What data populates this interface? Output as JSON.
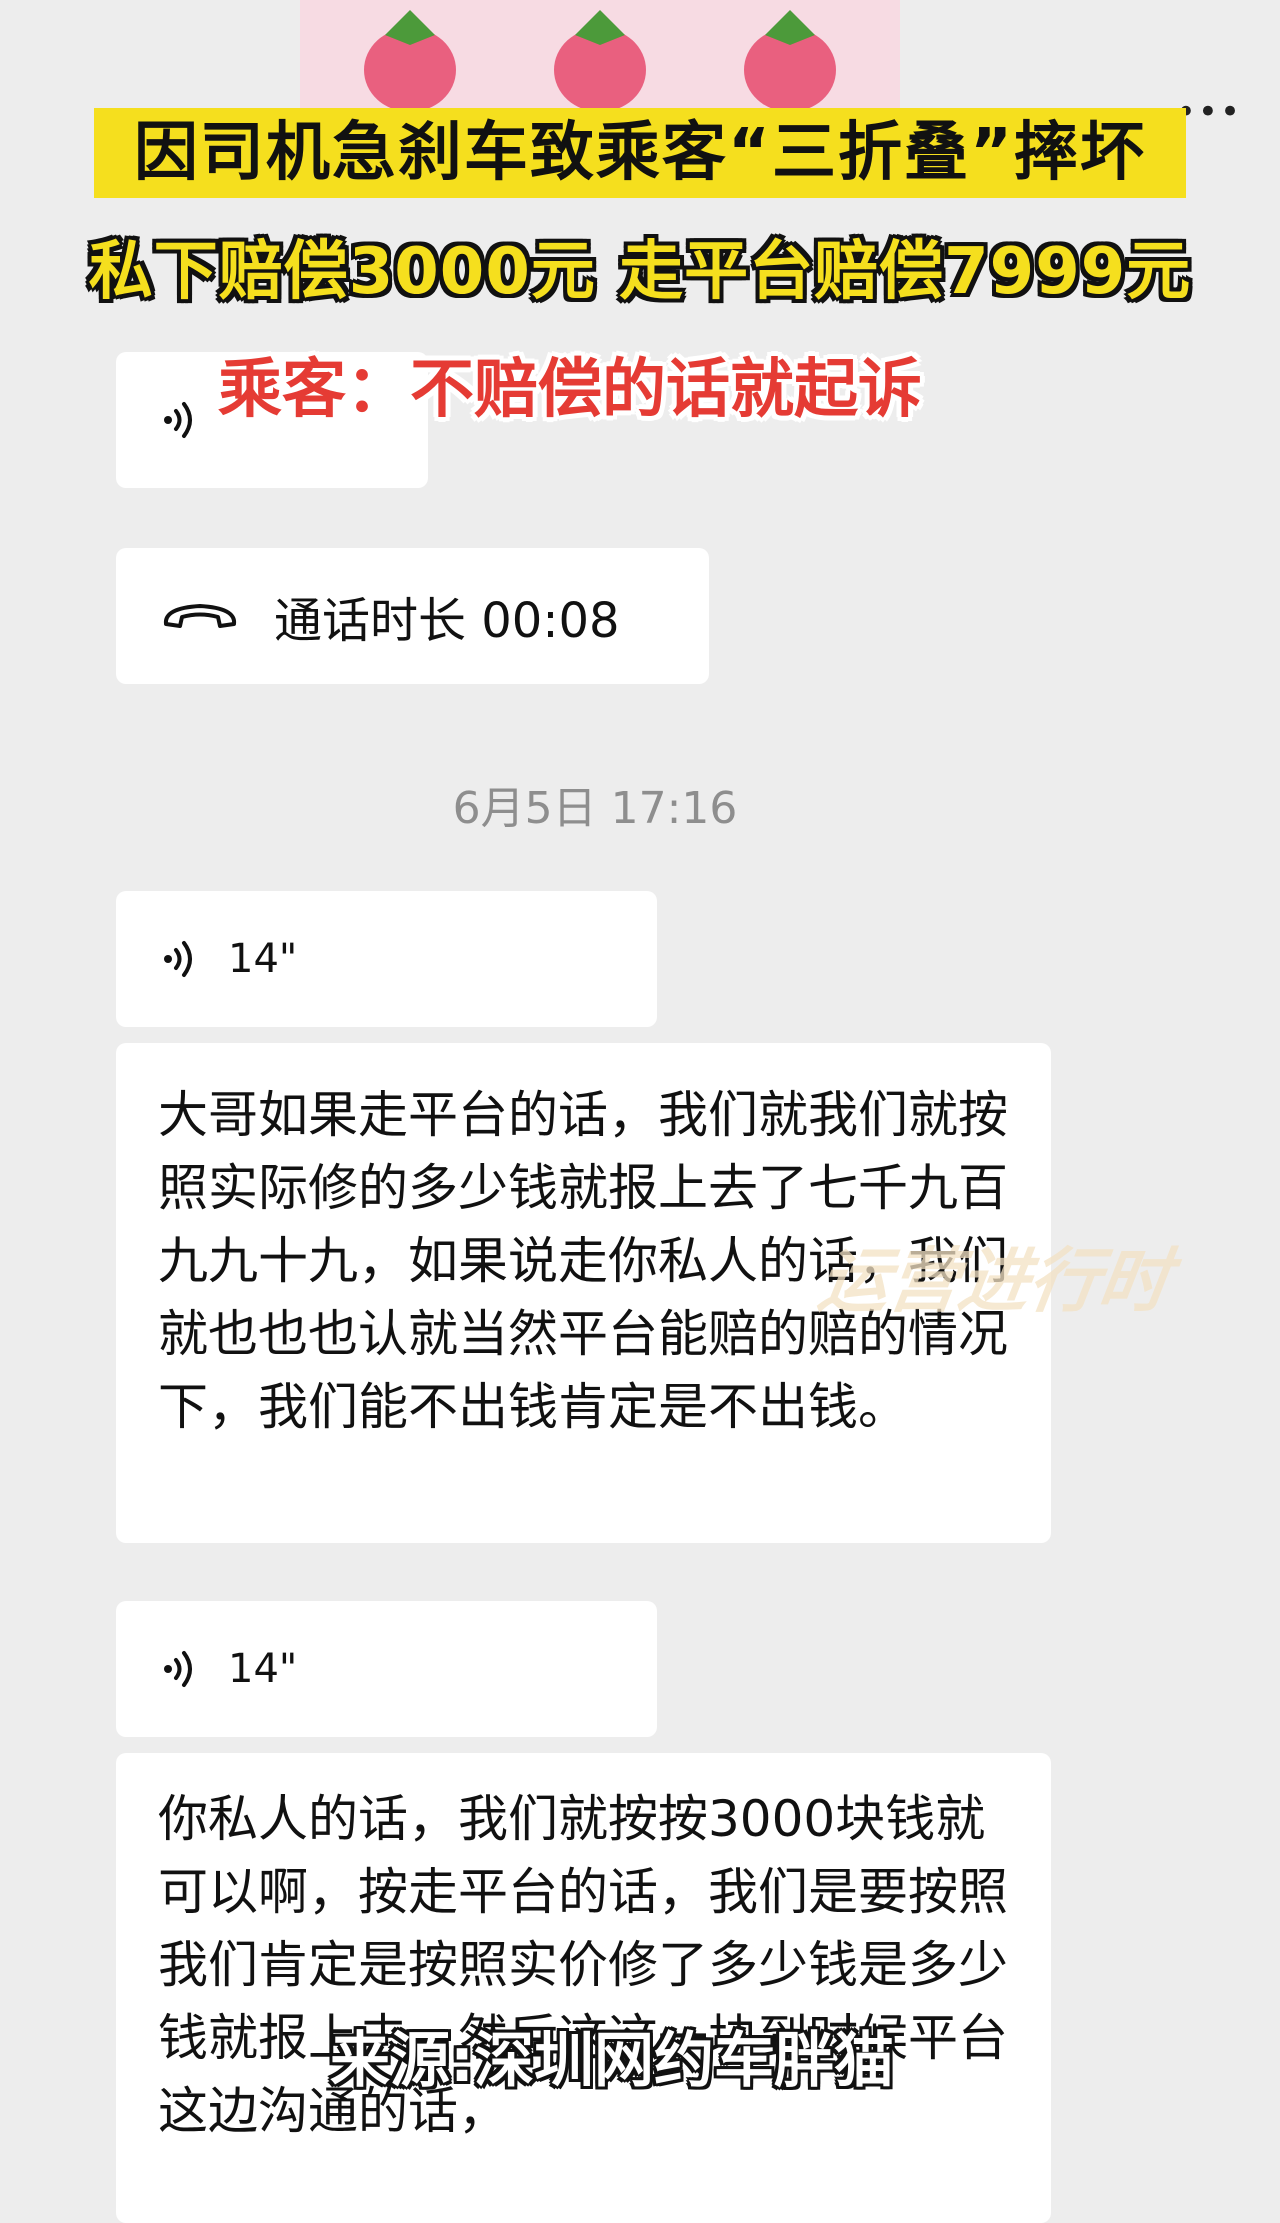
{
  "headline": {
    "line1": "因司机急刹车致乘客“三折叠”摔坏",
    "line2": "私下赔偿3000元 走平台赔偿7999元",
    "line3": "乘客：不赔偿的话就起诉"
  },
  "chat": {
    "call_record": "通话时长 00:08",
    "timestamp": "6月5日 17:16",
    "voice_messages": [
      {
        "duration": "14\""
      },
      {
        "duration": "14\""
      }
    ],
    "transcripts": [
      "大哥如果走平台的话，我们就我们就按照实际修的多少钱就报上去了七千九百九九十九，如果说走你私人的话，我们就也也也认就当然平台能赔的赔的情况下，我们能不出钱肯定是不出钱。",
      "你私人的话，我们就按按3000块钱就可以啊，按走平台的话，我们是要按照我们肯定是按照实价修了多少钱是多少钱就报上去，然后这这一块到时候平台这边沟通的话，"
    ]
  },
  "overlay": {
    "watermark": "运营进行时",
    "source": "来源:深圳网约车胖猫"
  },
  "colors": {
    "background": "#ededed",
    "headline_yellow": "#f5df1e",
    "headline_red": "#e53b34"
  },
  "icons": [
    "strawberry-icon",
    "more-icon",
    "voice-icon",
    "phone-icon"
  ]
}
